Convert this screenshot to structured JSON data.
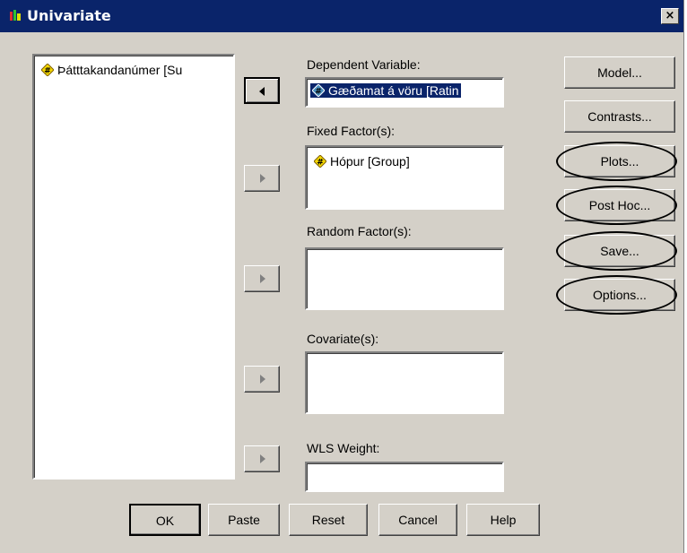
{
  "window": {
    "title": "Univariate",
    "close_glyph": "×"
  },
  "source_list": {
    "items": [
      {
        "label": "Þátttakandanúmer [Su",
        "icon": "numeric-scale-icon"
      }
    ]
  },
  "dependent": {
    "label": "Dependent Variable:",
    "value": "Gæðamat á vöru [Ratin",
    "icon": "ordinal-icon"
  },
  "fixed": {
    "label": "Fixed Factor(s):",
    "items": [
      {
        "label": "Hópur [Group]",
        "icon": "numeric-scale-icon"
      }
    ]
  },
  "random": {
    "label": "Random Factor(s):"
  },
  "covariate": {
    "label": "Covariate(s):"
  },
  "wls": {
    "label": "WLS Weight:"
  },
  "side_buttons": {
    "model": "Model...",
    "contrasts": "Contrasts...",
    "plots": "Plots...",
    "posthoc": "Post Hoc...",
    "save": "Save...",
    "options": "Options..."
  },
  "bottom_buttons": {
    "ok": "OK",
    "paste": "Paste",
    "reset": "Reset",
    "cancel": "Cancel",
    "help": "Help"
  },
  "colors": {
    "titlebar": "#0a246a",
    "dialog_bg": "#d4d0c8",
    "annotation_oval": "#000000"
  }
}
